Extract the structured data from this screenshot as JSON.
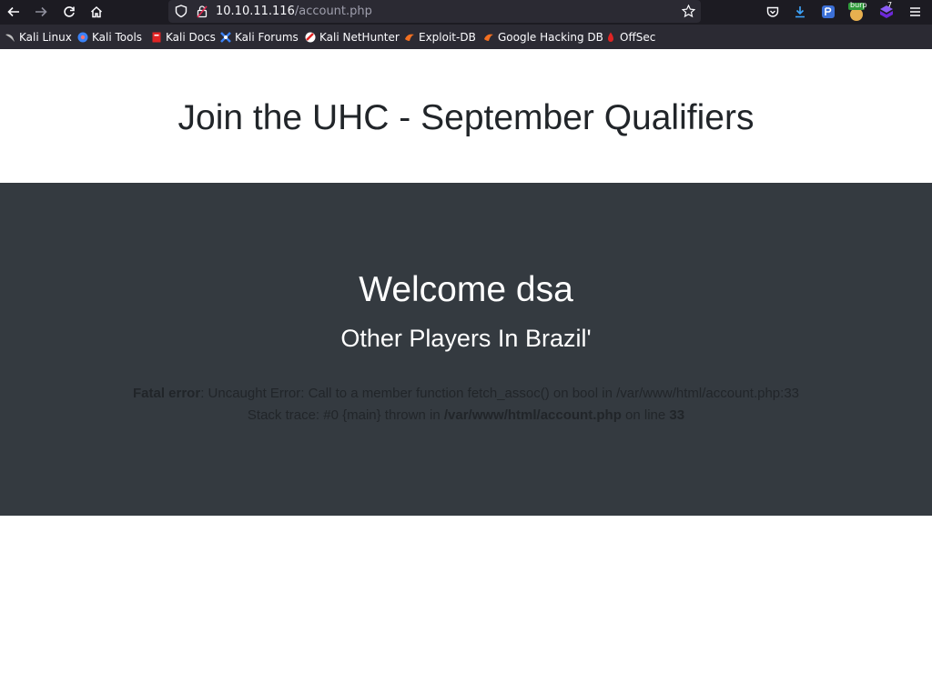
{
  "browser": {
    "url_host": "10.10.11.116",
    "url_path": "/account.php",
    "extensions": {
      "burp_label": "burp",
      "badge_count": "7"
    }
  },
  "bookmarks": [
    {
      "label": "Kali Linux",
      "icon": "kali-dragon-icon",
      "color": "#a6a6a6"
    },
    {
      "label": "Kali Tools",
      "icon": "kali-tools-icon",
      "color": "#3b82f6"
    },
    {
      "label": "Kali Docs",
      "icon": "kali-docs-icon",
      "color": "#e02424"
    },
    {
      "label": "Kali Forums",
      "icon": "kali-forums-icon",
      "color": "#3b82f6"
    },
    {
      "label": "Kali NetHunter",
      "icon": "nethunter-icon",
      "color": "#e02424"
    },
    {
      "label": "Exploit-DB",
      "icon": "exploit-db-icon",
      "color": "#f26f21"
    },
    {
      "label": "Google Hacking DB",
      "icon": "ghdb-icon",
      "color": "#f26f21"
    },
    {
      "label": "OffSec",
      "icon": "offsec-icon",
      "color": "#e02424"
    }
  ],
  "page": {
    "title": "Join the UHC - September Qualifiers",
    "welcome": "Welcome dsa",
    "subtitle": "Other Players In Brazil'",
    "error": {
      "label": "Fatal error",
      "message": ": Uncaught Error: Call to a member function fetch_assoc() on bool in /var/www/html/account.php:33",
      "trace_prefix": "Stack trace: #0 {main} thrown in ",
      "file": "/var/www/html/account.php",
      "on_line": " on line ",
      "line": "33"
    }
  },
  "colors": {
    "header_bg": "#343a40",
    "text": "#212529",
    "toolbar_bg": "#1c1b22",
    "bookmarks_bg": "#2b2a33"
  }
}
